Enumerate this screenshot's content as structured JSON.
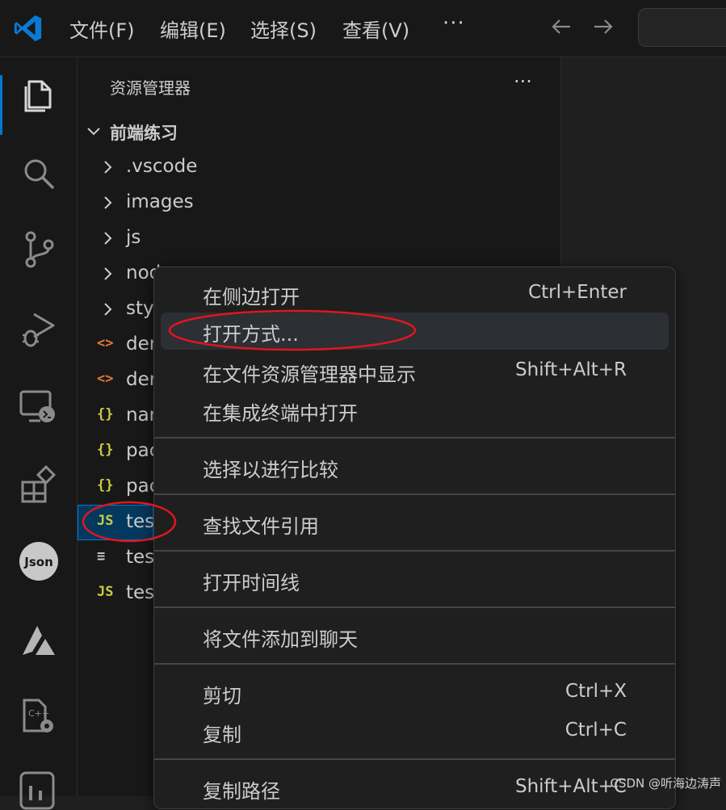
{
  "menubar": {
    "items": [
      "文件(F)",
      "编辑(E)",
      "选择(S)",
      "查看(V)"
    ],
    "more": "···"
  },
  "sidebar": {
    "title": "资源管理器",
    "more": "···",
    "folder": "前端练习",
    "items": [
      {
        "label": ".vscode",
        "icon": "chevron-right-icon"
      },
      {
        "label": "images",
        "icon": "chevron-right-icon"
      },
      {
        "label": "js",
        "icon": "chevron-right-icon"
      },
      {
        "label": "nod",
        "icon": "chevron-right-icon"
      },
      {
        "label": "sty",
        "icon": "chevron-right-icon"
      },
      {
        "label": "der",
        "icon": "html-file-icon",
        "glyph": "<>"
      },
      {
        "label": "der",
        "icon": "html-file-icon",
        "glyph": "<>"
      },
      {
        "label": "nar",
        "icon": "json-file-icon",
        "glyph": "{}"
      },
      {
        "label": "pac",
        "icon": "json-file-icon",
        "glyph": "{}"
      },
      {
        "label": "pac",
        "icon": "json-file-icon",
        "glyph": "{}"
      },
      {
        "label": "tes",
        "icon": "js-file-icon",
        "glyph": "JS"
      },
      {
        "label": "tes",
        "icon": "text-file-icon",
        "glyph": "≡"
      },
      {
        "label": "tes",
        "icon": "js-file-icon",
        "glyph": "JS"
      }
    ]
  },
  "context_menu": {
    "items": [
      {
        "label": "在侧边打开",
        "shortcut": "Ctrl+Enter"
      },
      {
        "label": "打开方式...",
        "shortcut": ""
      },
      {
        "label": "在文件资源管理器中显示",
        "shortcut": "Shift+Alt+R"
      },
      {
        "label": "在集成终端中打开",
        "shortcut": ""
      },
      {
        "label": "选择以进行比较",
        "shortcut": ""
      },
      {
        "label": "查找文件引用",
        "shortcut": ""
      },
      {
        "label": "打开时间线",
        "shortcut": ""
      },
      {
        "label": "将文件添加到聊天",
        "shortcut": ""
      },
      {
        "label": "剪切",
        "shortcut": "Ctrl+X"
      },
      {
        "label": "复制",
        "shortcut": "Ctrl+C"
      },
      {
        "label": "复制路径",
        "shortcut": "Shift+Alt+C"
      }
    ]
  },
  "watermark": "CSDN @听海边涛声",
  "colors": {
    "accent": "#0078d4",
    "annotation": "#e0161e",
    "js": "#cbcb41",
    "html": "#e37933",
    "json": "#cbcb41"
  }
}
